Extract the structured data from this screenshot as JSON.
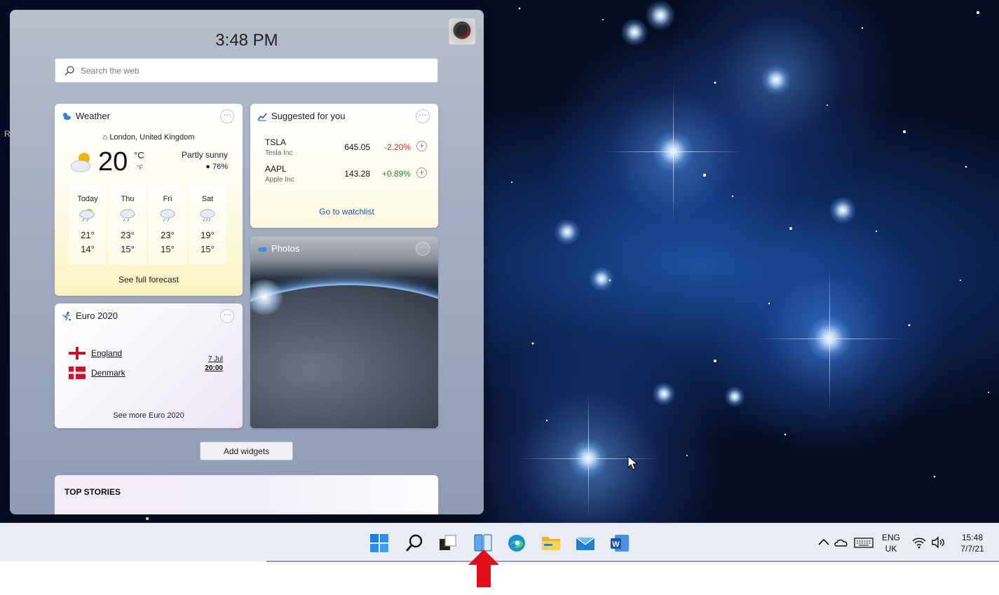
{
  "panel": {
    "time": "3:48 PM",
    "search_placeholder": "Search the web",
    "add_widgets_label": "Add widgets",
    "top_stories_label": "TOP STORIES"
  },
  "weather": {
    "title": "Weather",
    "location": "London, United Kingdom",
    "temperature": "20",
    "unit_c": "°C",
    "unit_f": "°F",
    "condition": "Partly sunny",
    "humidity": "76%",
    "forecast": [
      {
        "day": "Today",
        "high": "21°",
        "low": "14°",
        "icon": "thunder-shower-icon"
      },
      {
        "day": "Thu",
        "high": "23°",
        "low": "15°",
        "icon": "rain-cloud-icon"
      },
      {
        "day": "Fri",
        "high": "23°",
        "low": "15°",
        "icon": "rain-cloud-icon"
      },
      {
        "day": "Sat",
        "high": "19°",
        "low": "15°",
        "icon": "rain-cloud-icon"
      }
    ],
    "link": "See full forecast"
  },
  "stocks": {
    "title": "Suggested for you",
    "items": [
      {
        "symbol": "TSLA",
        "name": "Tesla Inc",
        "price": "645.05",
        "change": "-2.20%",
        "color": "#c0392b"
      },
      {
        "symbol": "AAPL",
        "name": "Apple Inc",
        "price": "143.28",
        "change": "+0.89%",
        "color": "#1e8a3a"
      }
    ],
    "link": "Go to watchlist"
  },
  "photos": {
    "title": "Photos"
  },
  "euro": {
    "title": "Euro 2020",
    "team1": "England",
    "team2": "Denmark",
    "date": "7 Jul",
    "time": "20:00",
    "link": "See more Euro 2020"
  },
  "taskbar": {
    "icons": [
      "start-icon",
      "search-icon",
      "task-view-icon",
      "widgets-icon",
      "edge-icon",
      "file-explorer-icon",
      "mail-icon",
      "word-icon"
    ],
    "lang_top": "ENG",
    "lang_bottom": "UK",
    "time": "15:48",
    "date": "7/7/21"
  },
  "desktop": {
    "edge_letter": "R"
  },
  "colors": {
    "accent": "#0a64c8",
    "negative": "#c0392b",
    "positive": "#1e8a3a",
    "arrow": "#e0101a"
  }
}
